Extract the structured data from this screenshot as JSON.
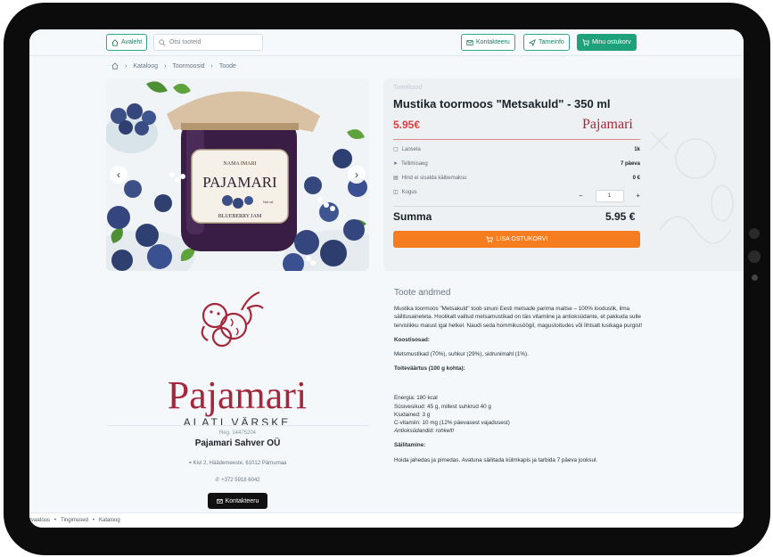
{
  "topbar": {
    "home_label": "Avaleht",
    "search_placeholder": "Otsi tooteid",
    "contact_label": "Kontakteeru",
    "delivery_label": "Tarneinfo",
    "cart_label": "Minu ostukorv"
  },
  "breadcrumb": [
    "Kataloog",
    "Toormoosid",
    "Toode"
  ],
  "product": {
    "code_label": "Tootekood",
    "title": "Mustika toormoos \"Metsakuld\" - 350 ml",
    "price": "5.95€",
    "brand": "Pajamari",
    "rows": [
      {
        "label": "Laosela",
        "value": "1k"
      },
      {
        "label": "Tellimisaeg",
        "value": "7 päeva"
      },
      {
        "label": "Hind ei sisalda käibemaksu",
        "value": "0 €"
      },
      {
        "label": "Kogus",
        "value": ""
      }
    ],
    "quantity": "1",
    "sum_label": "Summa",
    "sum_value": "5.95 €",
    "add_to_cart": "LISA OSTUKORVI"
  },
  "jar": {
    "label_top": "NAMA IMARI",
    "label_brand": "PAJAMARI",
    "label_small": "Net wt",
    "label_bottom": "BLUEBERRY JAM"
  },
  "seller": {
    "logo_name": "Pajamari",
    "tagline": "ALATI VÄRSKE",
    "reg": "Reg. 14475204",
    "name": "Pajamari Sahver OÜ",
    "address": "Kivi 2, Häädemeeste, 61012 Pärnumaa",
    "phone": "+372 5918 6042",
    "contact_button": "Kontakteeru"
  },
  "details": {
    "heading": "Toote andmed",
    "description": "Mustika toormoos \"Metsakuld\" toob sinuni Eesti metsade parima maitse – 100% looduslik, ilma säilitusaineteta. Hoolikalt valitud metsamustikad on täis vitamiine ja antioksüdante, et pakkuda sulle tervislikku maiust igal hetkel. Naudi seda hommikusöögil, magustoitudes või lihtsalt lusikaga purgist!",
    "ingredients_heading": "Koostisosad:",
    "ingredients": "Metsmustikad (70%), suhkur (29%), sidrunimahl (1%).",
    "nutrition_heading": "Toiteväärtus (100 g kohta):",
    "nutrition": [
      "Energia: 180 kcal",
      "Süsivesikud: 45 g, millest suhkrud 40 g",
      "Kiudained: 3 g",
      "C-vitamiin: 10 mg (12% päevasest vajadusest)",
      "Antioksüdandid: rohkelt!"
    ],
    "storage_heading": "Säilitamine:",
    "storage": "Hoida jahedas ja pimedas. Avatuna säilitada külmkapis ja tarbida 7 päeva jooksul."
  },
  "footer": [
    "rvaatous",
    "Tingimused",
    "Kataloog"
  ]
}
